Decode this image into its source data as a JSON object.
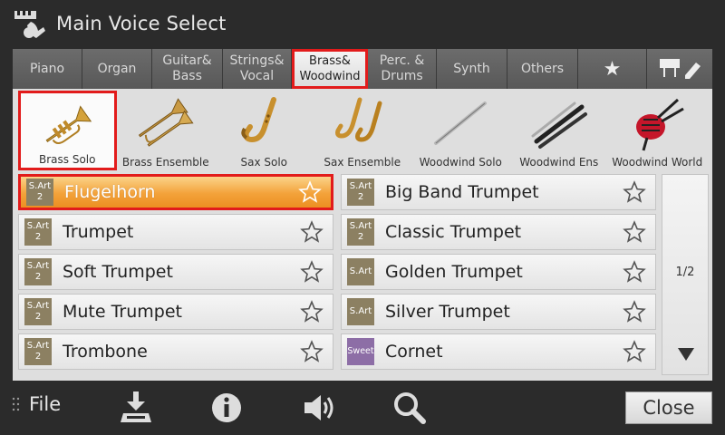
{
  "header": {
    "title": "Main Voice Select"
  },
  "tabs": [
    {
      "label": "Piano"
    },
    {
      "label": "Organ"
    },
    {
      "label": "Guitar&\nBass"
    },
    {
      "label": "Strings&\nVocal"
    },
    {
      "label": "Brass&\nWoodwind",
      "active": true
    },
    {
      "label": "Perc. &\nDrums"
    },
    {
      "label": "Synth"
    },
    {
      "label": "Others"
    },
    {
      "label": "★",
      "icon": "favorite-star-icon"
    },
    {
      "label": "",
      "icon": "piano-edit-icon"
    }
  ],
  "subcategories": [
    {
      "label": "Brass Solo",
      "active": true,
      "icon": "trumpet-icon"
    },
    {
      "label": "Brass Ensemble",
      "icon": "brass-ensemble-icon"
    },
    {
      "label": "Sax Solo",
      "icon": "saxophone-icon"
    },
    {
      "label": "Sax Ensemble",
      "icon": "sax-ensemble-icon"
    },
    {
      "label": "Woodwind Solo",
      "icon": "flute-icon"
    },
    {
      "label": "Woodwind Ens",
      "icon": "woodwind-ensemble-icon"
    },
    {
      "label": "Woodwind World",
      "icon": "bagpipe-icon"
    }
  ],
  "voices": [
    {
      "name": "Flugelhorn",
      "badge": "S.Art\n2",
      "active": true
    },
    {
      "name": "Big Band Trumpet",
      "badge": "S.Art\n2"
    },
    {
      "name": "Trumpet",
      "badge": "S.Art\n2"
    },
    {
      "name": "Classic Trumpet",
      "badge": "S.Art\n2"
    },
    {
      "name": "Soft Trumpet",
      "badge": "S.Art\n2"
    },
    {
      "name": "Golden Trumpet",
      "badge": "S.Art"
    },
    {
      "name": "Mute Trumpet",
      "badge": "S.Art\n2"
    },
    {
      "name": "Silver Trumpet",
      "badge": "S.Art"
    },
    {
      "name": "Trombone",
      "badge": "S.Art\n2"
    },
    {
      "name": "Cornet",
      "badge": "Sweet"
    }
  ],
  "pager": {
    "page": "1/2"
  },
  "footer": {
    "file_label": "File",
    "close_label": "Close"
  },
  "colors": {
    "highlight_border": "#e21b1b",
    "selected_voice": "#f3a23a",
    "badge_sart": "#8c8062",
    "badge_sweet": "#8d6ea6"
  }
}
